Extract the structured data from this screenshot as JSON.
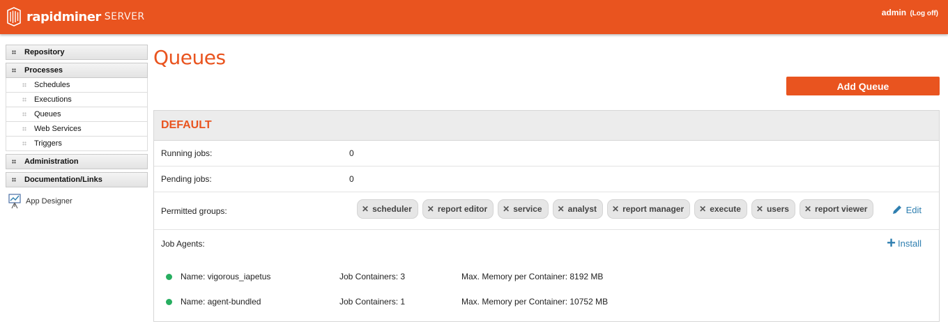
{
  "header": {
    "brand": "rapidminer",
    "brand_sub": "SERVER",
    "user": "admin",
    "logoff": "(Log off)",
    "accent_color": "#e9541f"
  },
  "sidebar": {
    "sections": [
      {
        "label": "Repository"
      },
      {
        "label": "Processes",
        "items": [
          "Schedules",
          "Executions",
          "Queues",
          "Web Services",
          "Triggers"
        ]
      },
      {
        "label": "Administration"
      },
      {
        "label": "Documentation/Links"
      }
    ],
    "app_designer": "App Designer"
  },
  "main": {
    "title": "Queues",
    "add_button": "Add Queue",
    "queue": {
      "name": "DEFAULT",
      "running_label": "Running jobs:",
      "running_value": "0",
      "pending_label": "Pending jobs:",
      "pending_value": "0",
      "permitted_label": "Permitted groups:",
      "groups": [
        "scheduler",
        "report editor",
        "service",
        "analyst",
        "report manager",
        "execute",
        "users",
        "report viewer"
      ],
      "edit_label": "Edit",
      "agents_label": "Job Agents:",
      "install_label": "Install",
      "agents": [
        {
          "name": "Name: vigorous_iapetus",
          "containers": "Job Containers: 3",
          "memory": "Max. Memory per Container: 8192 MB",
          "status_color": "#27ae60"
        },
        {
          "name": "Name: agent-bundled",
          "containers": "Job Containers: 1",
          "memory": "Max. Memory per Container: 10752 MB",
          "status_color": "#27ae60"
        }
      ]
    }
  }
}
